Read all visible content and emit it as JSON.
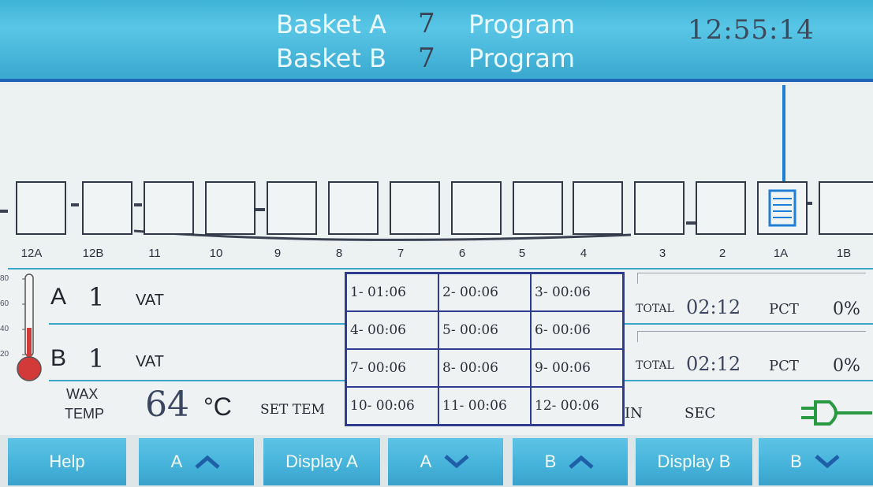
{
  "header": {
    "basket_a_label": "Basket A",
    "basket_a_program": "7",
    "basket_a_suffix": "Program",
    "basket_b_label": "Basket B",
    "basket_b_program": "7",
    "basket_b_suffix": "Program",
    "clock": "12:55:14"
  },
  "stations": [
    "12A",
    "12B",
    "11",
    "10",
    "9",
    "8",
    "7",
    "6",
    "5",
    "4",
    "3",
    "2",
    "1A",
    "1B"
  ],
  "thermometer": {
    "ticks": [
      "80",
      "60",
      "40",
      "20"
    ]
  },
  "basket_a": {
    "letter": "A",
    "number": "1",
    "unit": "VAT"
  },
  "basket_b": {
    "letter": "B",
    "number": "1",
    "unit": "VAT"
  },
  "wax": {
    "label_line1": "WAX",
    "label_line2": "TEMP",
    "value": "64",
    "unit": "°C",
    "set_label": "SET TEM"
  },
  "steps": [
    "1- 01:06",
    "2- 00:06",
    "3- 00:06",
    "4- 00:06",
    "5- 00:06",
    "6- 00:06",
    "7- 00:06",
    "8- 00:06",
    "9- 00:06",
    "10- 00:06",
    "11- 00:06",
    "12- 00:06"
  ],
  "totals": {
    "a": {
      "label": "TOTAL",
      "value": "02:12",
      "pct_label": "PCT",
      "pct_value": "0%"
    },
    "b": {
      "label": "TOTAL",
      "value": "02:12",
      "pct_label": "PCT",
      "pct_value": "0%"
    }
  },
  "time_units": {
    "min": "IN",
    "sec": "SEC"
  },
  "footer": {
    "help": "Help",
    "a_up": "A",
    "display_a": "Display A",
    "a_down": "A",
    "b_up": "B",
    "display_b": "Display B",
    "b_down": "B"
  },
  "colors": {
    "header": "#3fb3d6",
    "button": "#45b2da",
    "grid_border": "#2f3b8e",
    "accent_line": "#1e63b8",
    "thermometer": "#d23a3a"
  }
}
